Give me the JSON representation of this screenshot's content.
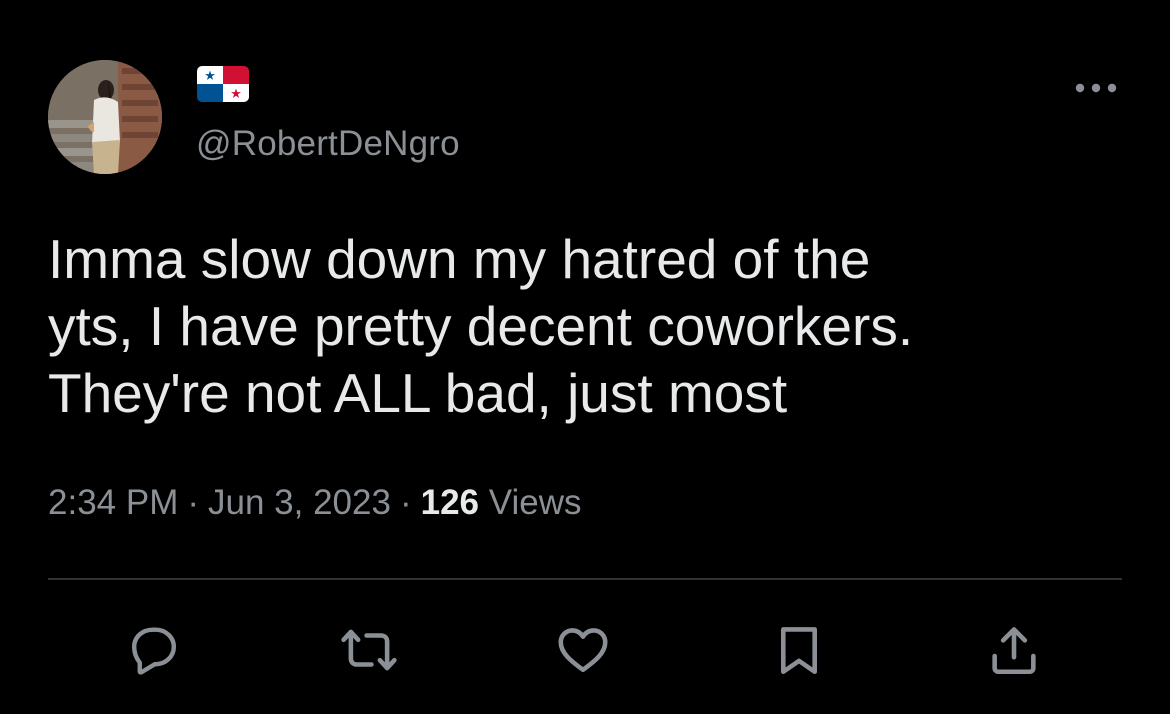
{
  "tweet": {
    "handle": "@RobertDeNgro",
    "text": "Imma slow down my hatred of the\nyts, I have pretty decent coworkers.\nThey're not ALL bad, just most",
    "time": "2:34 PM",
    "separator": "·",
    "date": "Jun 3, 2023",
    "views_count": "126",
    "views_label": "Views"
  },
  "icons": {
    "flag": "panama-flag-icon",
    "more": "more-options-icon",
    "reply": "reply-icon",
    "retweet": "retweet-icon",
    "like": "like-icon",
    "bookmark": "bookmark-icon",
    "share": "share-icon"
  },
  "colors": {
    "background": "#000000",
    "text_primary": "#e7e9ea",
    "text_secondary": "#8b9096",
    "divider": "#2f3336",
    "flag_red": "#d21034",
    "flag_blue": "#005293"
  }
}
